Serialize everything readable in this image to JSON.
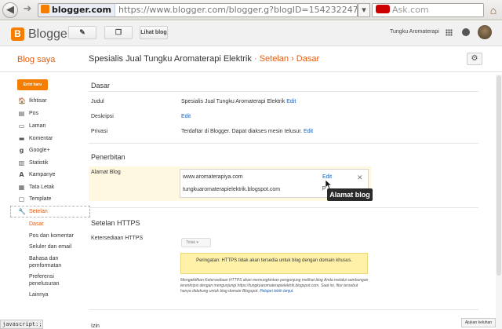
{
  "browser": {
    "back": "◀",
    "forward": "➜",
    "domain": "blogger.com",
    "url": "https://www.blogger.com/blogger.g?blogID=154232247776371959",
    "search_placeholder": "Ask.com",
    "reload": "▾"
  },
  "header": {
    "logo_letter": "B",
    "logo_text": "Blogger",
    "lihat_blog": "Lihat blog",
    "account_name": "Tungku Aromaterapi"
  },
  "titlebar": {
    "blog_saya": "Blog saya",
    "blog_name": "Spesialis Jual Tungku Aromaterapi Elektrik",
    "sep": "·",
    "setelan": "Setelan",
    "arrow": "›",
    "dasar": "Dasar"
  },
  "sidebar": {
    "new_post": "Entri baru",
    "items": [
      {
        "label": "Ikhtisar",
        "icon": "🏠"
      },
      {
        "label": "Pos",
        "icon": "▤"
      },
      {
        "label": "Laman",
        "icon": "▭"
      },
      {
        "label": "Komentar",
        "icon": "▬"
      },
      {
        "label": "Google+",
        "icon": "g"
      },
      {
        "label": "Statistik",
        "icon": "▥"
      },
      {
        "label": "Kampanye",
        "icon": "A"
      },
      {
        "label": "Tata Letak",
        "icon": "▦"
      },
      {
        "label": "Template",
        "icon": "▢"
      },
      {
        "label": "Setelan",
        "icon": "🔧"
      }
    ],
    "sub_items": [
      "Dasar",
      "Pos dan komentar",
      "Seluler dan email",
      "Bahasa dan",
      "pemformatan",
      "Preferensi",
      "penelusuran",
      "Lainnya"
    ]
  },
  "main": {
    "dasar_title": "Dasar",
    "judul_label": "Judul",
    "judul_value": "Spesialis Jual Tungku Aromaterapi Elektrik",
    "deskripsi_label": "Deskripsi",
    "privasi_label": "Privasi",
    "privasi_value": "Terdaftar di Blogger. Dapat diakses mesin telusur.",
    "edit": "Edit",
    "penerbitan_title": "Penerbitan",
    "alamat_label": "Alamat Blog",
    "alamat_custom": "www.aromaterapiya.com",
    "alamat_blogspot": "tungkuaromaterapielektrik.blogspot.com",
    "alamat_close": "✕",
    "alamat_fragment": "p",
    "tooltip": "Alamat blog",
    "https_title": "Setelan HTTPS",
    "https_label": "Ketersediaan HTTPS",
    "https_select": "Tidak ▾",
    "https_warning": "Peringatan: HTTPS tidak akan tersedia untuk blog dengan domain khusus.",
    "https_note": "Mengaktifkan Ketersediaan HTTPS akan memungkinkan pengunjung melihat blog Anda melalui sambungan terenkripsi dengan mengunjungi https://tungkuaromaterapielektrik.blogspot.com. Saat ini, fitur tersebut hanya didukung untuk blog domain Blogspot.",
    "https_learn_more": "Pelajari lebih lanjut.",
    "partial_next": "Izin"
  },
  "status_bar": "javascript:;",
  "feedback": "Ajukan keluhan"
}
